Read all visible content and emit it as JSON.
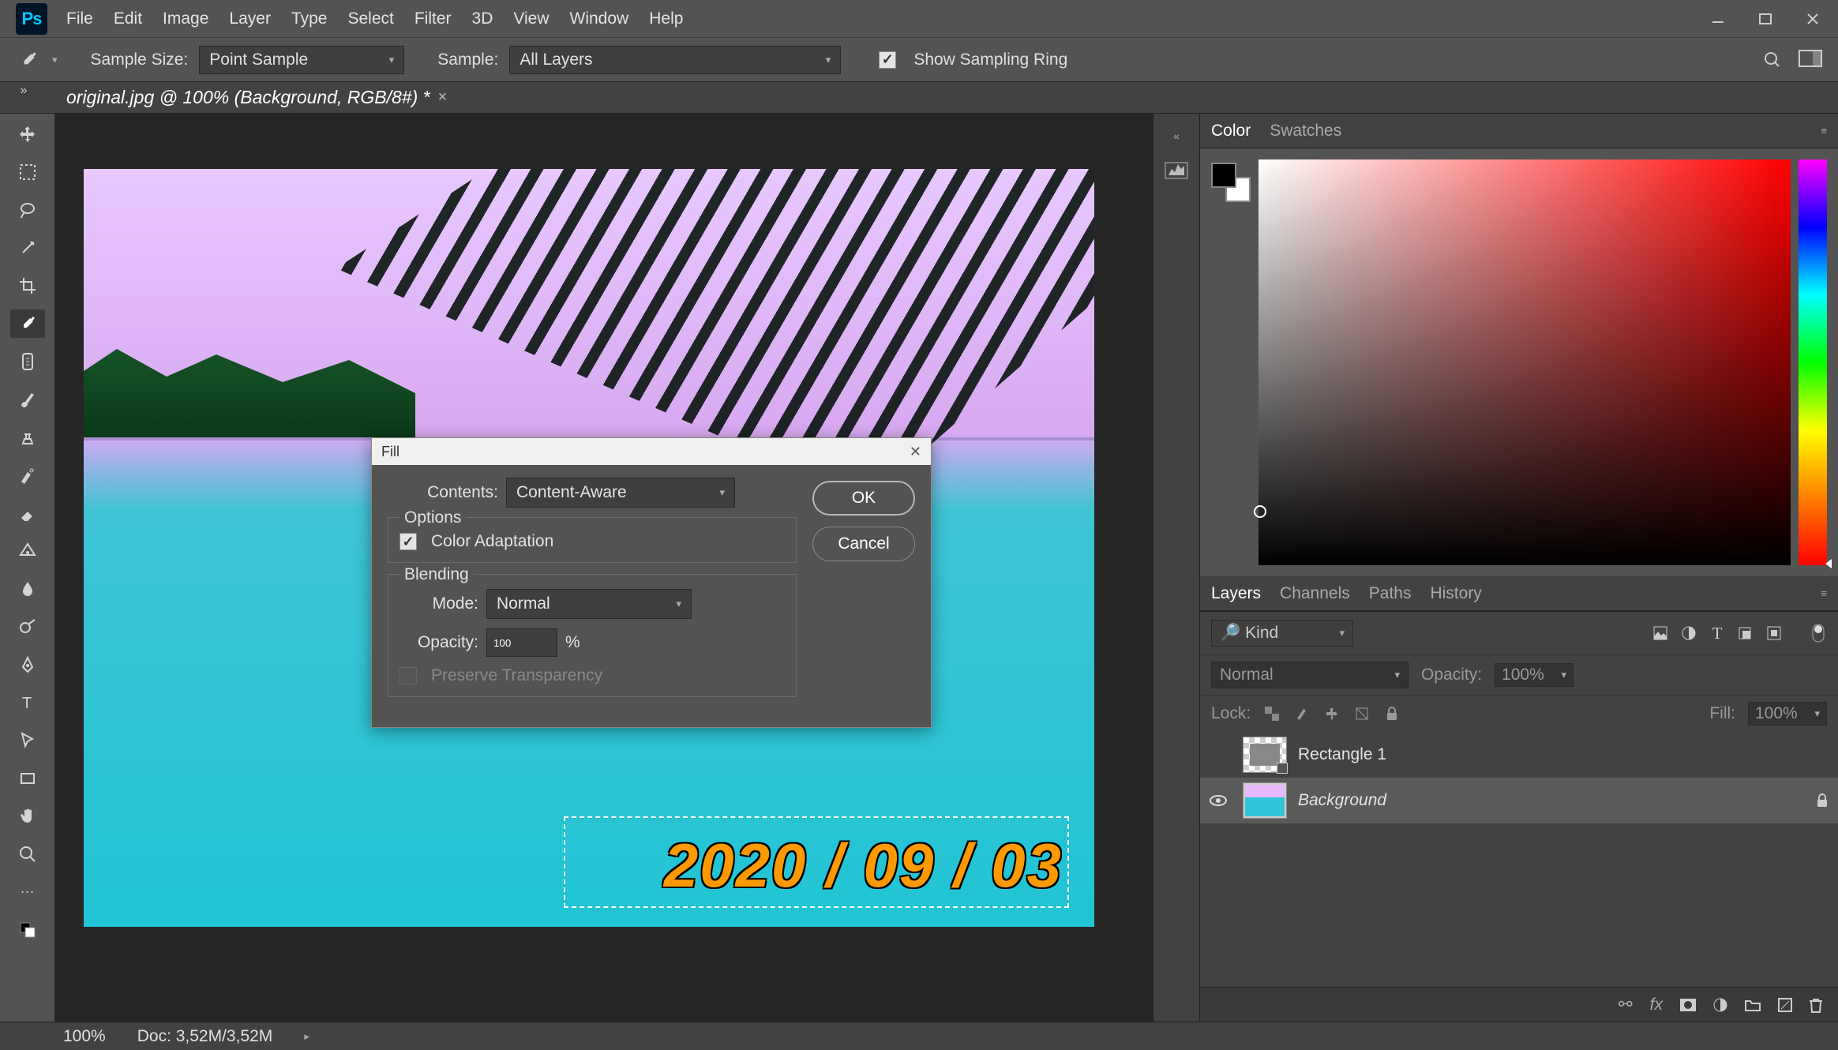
{
  "menu": [
    "File",
    "Edit",
    "Image",
    "Layer",
    "Type",
    "Select",
    "Filter",
    "3D",
    "View",
    "Window",
    "Help"
  ],
  "options_bar": {
    "sample_size_label": "Sample Size:",
    "sample_size_value": "Point Sample",
    "sample_label": "Sample:",
    "sample_value": "All Layers",
    "show_sampling_ring": "Show Sampling Ring"
  },
  "doc_tab": {
    "title": "original.jpg @ 100% (Background, RGB/8#) *"
  },
  "canvas": {
    "date_stamp": "2020 / 09 / 03"
  },
  "status": {
    "zoom": "100%",
    "doc": "Doc: 3,52M/3,52M"
  },
  "color_panel": {
    "tabs": [
      "Color",
      "Swatches"
    ]
  },
  "layers_panel": {
    "tabs": [
      "Layers",
      "Channels",
      "Paths",
      "History"
    ],
    "kind_placeholder": "Kind",
    "blend_mode": "Normal",
    "opacity_label": "Opacity:",
    "opacity_value": "100%",
    "lock_label": "Lock:",
    "fill_label": "Fill:",
    "fill_value": "100%",
    "items": [
      {
        "visible": false,
        "name": "Rectangle 1",
        "italic": false,
        "locked": false
      },
      {
        "visible": true,
        "name": "Background",
        "italic": true,
        "locked": true
      }
    ]
  },
  "dialog": {
    "title": "Fill",
    "contents_label": "Contents:",
    "contents_value": "Content-Aware",
    "options_legend": "Options",
    "color_adaptation": "Color Adaptation",
    "blending_legend": "Blending",
    "mode_label": "Mode:",
    "mode_value": "Normal",
    "opacity_label": "Opacity:",
    "opacity_value": "100",
    "opacity_pct": "%",
    "preserve_transparency": "Preserve Transparency",
    "ok": "OK",
    "cancel": "Cancel"
  }
}
